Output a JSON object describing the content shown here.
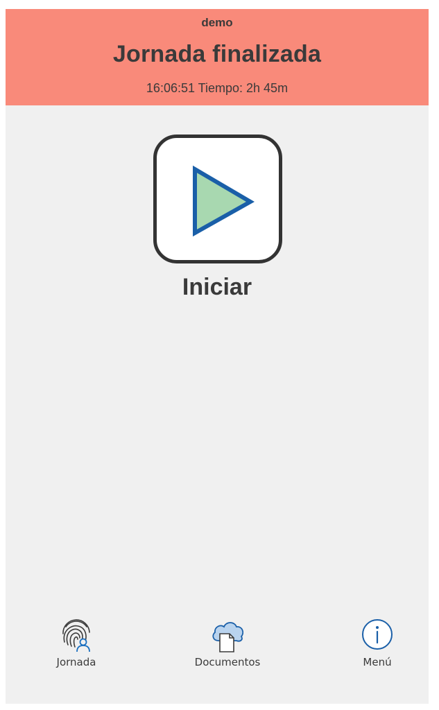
{
  "header": {
    "user": "demo",
    "status_title": "Jornada finalizada",
    "status_line": "16:06:51 Tiempo: 2h 45m",
    "background": "#f98a7a"
  },
  "main": {
    "start_label": "Iniciar",
    "play_icon": "play-triangle-icon",
    "play_fill": "#a8d8b0",
    "play_stroke": "#1a5fa8"
  },
  "nav": {
    "items": [
      {
        "label": "Jornada",
        "icon": "fingerprint-user-icon"
      },
      {
        "label": "Documentos",
        "icon": "cloud-document-icon"
      },
      {
        "label": "Menú",
        "icon": "info-icon"
      }
    ]
  }
}
